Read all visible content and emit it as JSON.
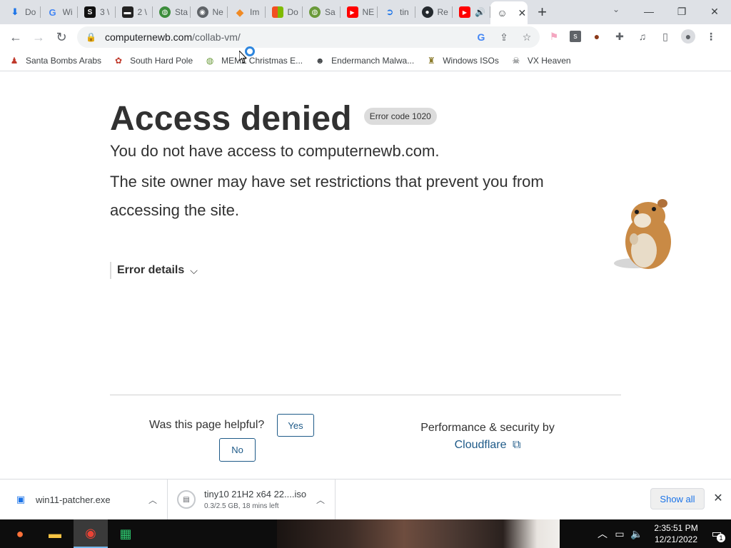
{
  "browser": {
    "tabs": [
      {
        "label": "Do",
        "icon": "download-icon",
        "color": "#1a73e8"
      },
      {
        "label": "Wi",
        "icon": "google-icon",
        "color": "#4285f4"
      },
      {
        "label": "3 \\",
        "icon": "s-logo-icon",
        "color": "#111111"
      },
      {
        "label": "2 \\",
        "icon": "terminal-icon",
        "color": "#222222"
      },
      {
        "label": "Sta",
        "icon": "globe-icon",
        "color": "#3c8d3c"
      },
      {
        "label": "Ne",
        "icon": "chromium-icon",
        "color": "#5f6368"
      },
      {
        "label": "Im",
        "icon": "diamond-icon",
        "color": "#f08a24"
      },
      {
        "label": "Do",
        "icon": "windows-icon",
        "color": "#00a4ef"
      },
      {
        "label": "Sa",
        "icon": "globe-icon",
        "color": "#6a9a3a"
      },
      {
        "label": "NE",
        "icon": "youtube-icon",
        "color": "#ff0000"
      },
      {
        "label": "tin",
        "icon": "spiral-icon",
        "color": "#1a73e8"
      },
      {
        "label": "Re",
        "icon": "github-icon",
        "color": "#24292e"
      },
      {
        "label": "",
        "icon": "youtube-audio-icon",
        "color": "#ff0000"
      }
    ],
    "active_tab": {
      "label": "",
      "icon": "hamster-icon"
    },
    "new_tab": "+",
    "window_controls": {
      "minimize": "—",
      "restore": "❐",
      "close": "✕"
    },
    "url_host": "computernewb.com",
    "url_path": "/collab-vm/"
  },
  "bookmarks": [
    {
      "label": "Santa Bombs Arabs",
      "icon": "santa-icon"
    },
    {
      "label": "South Hard Pole",
      "icon": "flower-icon"
    },
    {
      "label": "MEMZ Christmas E...",
      "icon": "globe-icon"
    },
    {
      "label": "Endermanch Malwa...",
      "icon": "cat-icon"
    },
    {
      "label": "Windows ISOs",
      "icon": "trophy-icon"
    },
    {
      "label": "VX Heaven",
      "icon": "skull-icon"
    }
  ],
  "page": {
    "title": "Access denied",
    "error_code": "Error code 1020",
    "subtitle": "You do not have access to computernewb.com.",
    "paragraph": "The site owner may have set restrictions that prevent you from accessing the site.",
    "details_label": "Error details",
    "helpful_question": "Was this page helpful?",
    "yes_label": "Yes",
    "no_label": "No",
    "perf_text": "Performance & security by",
    "cloudflare_link": "Cloudflare"
  },
  "downloads": [
    {
      "name": "win11-patcher.exe",
      "status": ""
    },
    {
      "name": "tiny10 21H2 x64 22....iso",
      "status": "0.3/2.5 GB, 18 mins left"
    }
  ],
  "downloads_show_all": "Show all",
  "taskbar": {
    "time": "2:35:51 PM",
    "date": "12/21/2022",
    "notifications": "1"
  },
  "colors": {
    "link": "#1e5a88",
    "badge_bg": "#dcdcdc",
    "text": "#313131"
  }
}
